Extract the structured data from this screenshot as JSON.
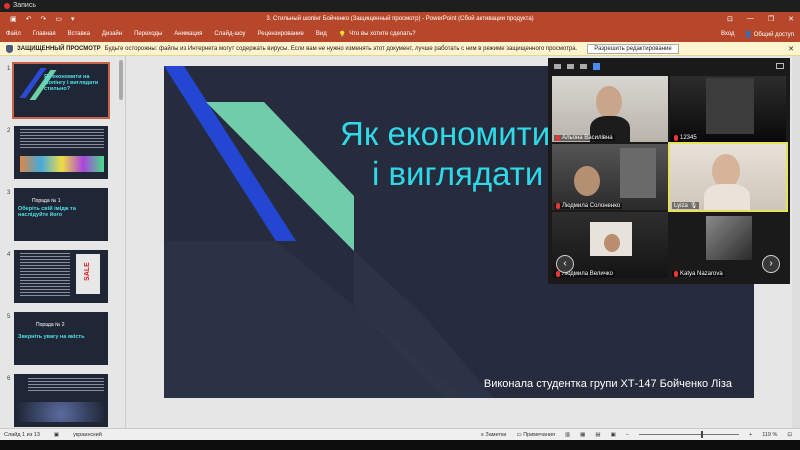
{
  "recorder": {
    "label": "Запись"
  },
  "window": {
    "title": "3. Стильный шопінг Бойченко (Защищенный просмотр) - PowerPoint (Сбой активации продукта)",
    "controls": [
      "—",
      "❐",
      "✕"
    ]
  },
  "ribbon": {
    "tabs": [
      "Файл",
      "Главная",
      "Вставка",
      "Дизайн",
      "Переходы",
      "Анимация",
      "Слайд-шоу",
      "Рецензирование",
      "Вид"
    ],
    "tell_me": "Что вы хотите сделать?",
    "sign_in": "Вход",
    "share": "Общий доступ"
  },
  "protected_view": {
    "label": "ЗАЩИЩЕННЫЙ ПРОСМОТР",
    "message": "Будьте осторожны: файлы из Интернета могут содержать вирусы. Если вам не нужно изменять этот документ, лучше работать с ним в режиме защищенного просмотра.",
    "enable_button": "Разрешить редактирование"
  },
  "thumbnails": [
    {
      "num": "1",
      "text": "Як економити на шопінгу і виглядати стильно?"
    },
    {
      "num": "2",
      "text": ""
    },
    {
      "num": "3",
      "text": "Оберіть свій імідж та наслідуйте його",
      "small": "Порада № 1"
    },
    {
      "num": "4",
      "text": "SALE"
    },
    {
      "num": "5",
      "text": "Зверніть увагу на якість",
      "small": "Порада № 2"
    },
    {
      "num": "6",
      "text": ""
    }
  ],
  "slide": {
    "title_line1": "Як економити",
    "title_line2": "і виглядати",
    "footer": "Виконала студентка групи ХТ-147 Бойченко Ліза"
  },
  "zoom": {
    "participants": [
      {
        "name": "Альона Василівна",
        "muted": true
      },
      {
        "name": "12345",
        "muted": true
      },
      {
        "name": "Людмила Солоненко",
        "muted": true
      },
      {
        "name": "Lyiza",
        "muted": false
      },
      {
        "name": "Людмила Величко",
        "muted": true
      },
      {
        "name": "Katya Nazarova",
        "muted": true
      }
    ],
    "prev": "‹",
    "next": "›"
  },
  "status": {
    "slide_info": "Слайд 1 из 13",
    "language": "украинский",
    "notes": "Заметки",
    "comments": "Примечания",
    "zoom": "119 %"
  },
  "colors": {
    "accent": "#b7472a",
    "slide_bg": "#262c3d",
    "title": "#2fd9e7"
  }
}
